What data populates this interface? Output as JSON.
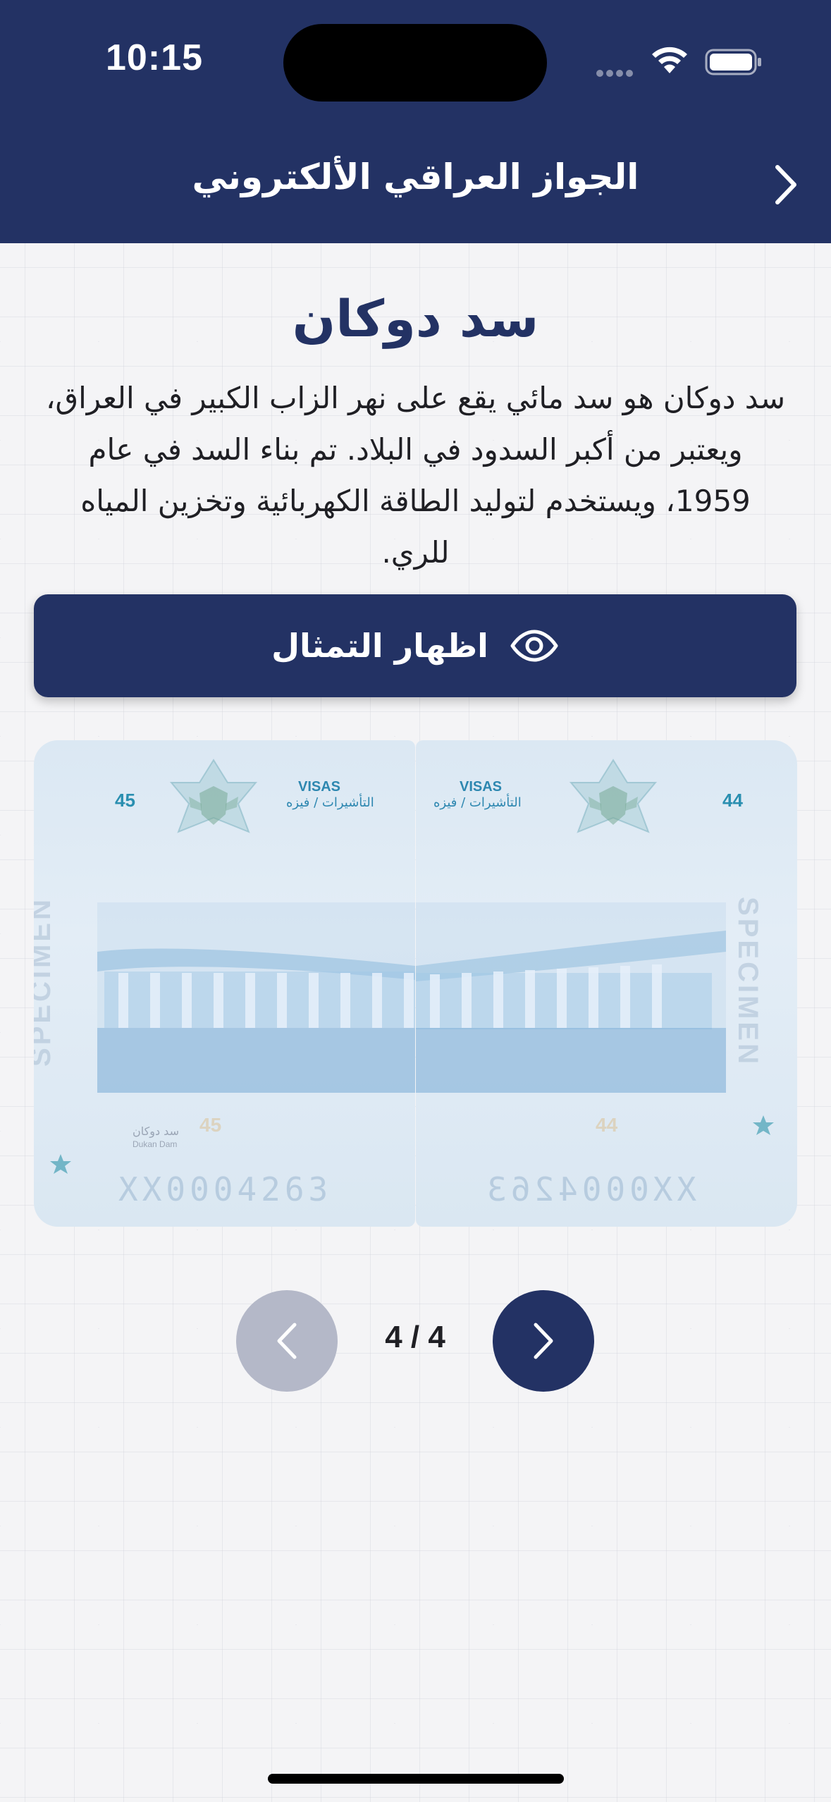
{
  "status_bar": {
    "time": "10:15"
  },
  "header": {
    "title": "الجواز العراقي الألكتروني",
    "background_color": "#233264",
    "back_icon": "chevron-right-icon"
  },
  "content": {
    "title": "سد دوكان",
    "description": "سد دوكان هو سد مائي يقع على نهر الزاب الكبير في العراق، ويعتبر من أكبر السدود في البلاد. تم بناء السد في عام 1959، ويستخدم لتوليد الطاقة الكهربائية وتخزين المياه للري.",
    "show_button": {
      "label": "اظهار التمثال",
      "icon": "eye-icon"
    }
  },
  "passport_image": {
    "left_page": {
      "number": "45",
      "visas_en": "VISAS",
      "visas_ar": "التأشيرات / فيزه",
      "watermark": "SPECIMEN",
      "caption_ar": "سد دوكان",
      "caption_en": "Dukan Dam",
      "mrz": "XX0004263",
      "badge": "45",
      "ghost_number": "45"
    },
    "right_page": {
      "number": "44",
      "visas_en": "VISAS",
      "visas_ar": "التأشيرات / فيزه",
      "watermark": "SPECIMEN",
      "mrz": "XX0004263",
      "badge": "44",
      "ghost_number": "44"
    }
  },
  "pager": {
    "counter": "4 / 4",
    "prev_icon": "chevron-left-icon",
    "next_icon": "chevron-right-icon",
    "accent_color": "#233264",
    "disabled_color": "#b4b8c8"
  }
}
